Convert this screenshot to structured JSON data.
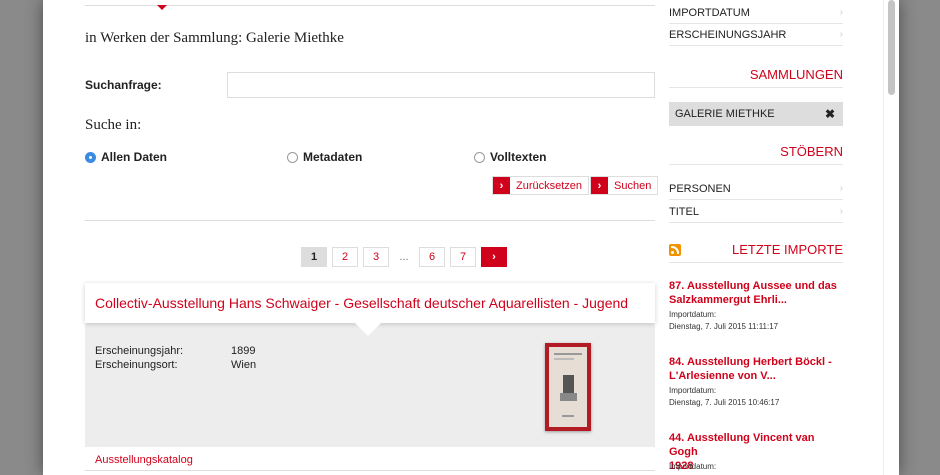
{
  "main": {
    "heading": "in Werken der Sammlung: Galerie Miethke",
    "search_label": "Suchanfrage:",
    "search_value": "",
    "suche_in": "Suche in:",
    "radios": [
      {
        "label": "Allen Daten",
        "checked": true
      },
      {
        "label": "Metadaten",
        "checked": false
      },
      {
        "label": "Volltexten",
        "checked": false
      }
    ],
    "buttons": {
      "reset": "Zurücksetzen",
      "search": "Suchen",
      "arrow": "›"
    },
    "pagination": {
      "pages": [
        "1",
        "2",
        "3",
        "...",
        "6",
        "7"
      ],
      "current": "1",
      "next": "›"
    },
    "result": {
      "title": "Collectiv-Ausstellung Hans Schwaiger - Gesellschaft deutscher Aquarellisten - Jugend",
      "fields": [
        {
          "key": "Erscheinungsjahr:",
          "value": "1899"
        },
        {
          "key": "Erscheinungsort:",
          "value": "Wien"
        }
      ],
      "type": "Ausstellungskatalog"
    }
  },
  "sidebar": {
    "sort_items": [
      {
        "label": "IMPORTDATUM"
      },
      {
        "label": "ERSCHEINUNGSJAHR"
      }
    ],
    "sammlungen_heading": "SAMMLUNGEN",
    "active_filter": {
      "label": "GALERIE MIETHKE",
      "remove": "✖"
    },
    "stoebern_heading": "STÖBERN",
    "stoebern_items": [
      {
        "label": "PERSONEN"
      },
      {
        "label": "TITEL"
      }
    ],
    "imports_heading": "LETZTE IMPORTE",
    "imports": [
      {
        "title_lines": [
          "87. Ausstellung Aussee und das",
          "Salzkammergut Ehrli..."
        ],
        "label": "Importdatum:",
        "date": "Dienstag, 7. Juli 2015 11:11:17"
      },
      {
        "title_lines": [
          "84. Ausstellung Herbert Böckl -",
          "L'Arlesienne von V..."
        ],
        "label": "Importdatum:",
        "date": "Dienstag, 7. Juli 2015 10:46:17"
      },
      {
        "title_lines": [
          "44. Ausstellung Vincent van Gogh",
          "1928"
        ],
        "label": "Importdatum:",
        "date": ""
      }
    ],
    "chevron": "›"
  },
  "colors": {
    "accent": "#d0021b",
    "panel": "#ededed",
    "radio_on": "#3b8be0",
    "rss": "#f39200"
  }
}
